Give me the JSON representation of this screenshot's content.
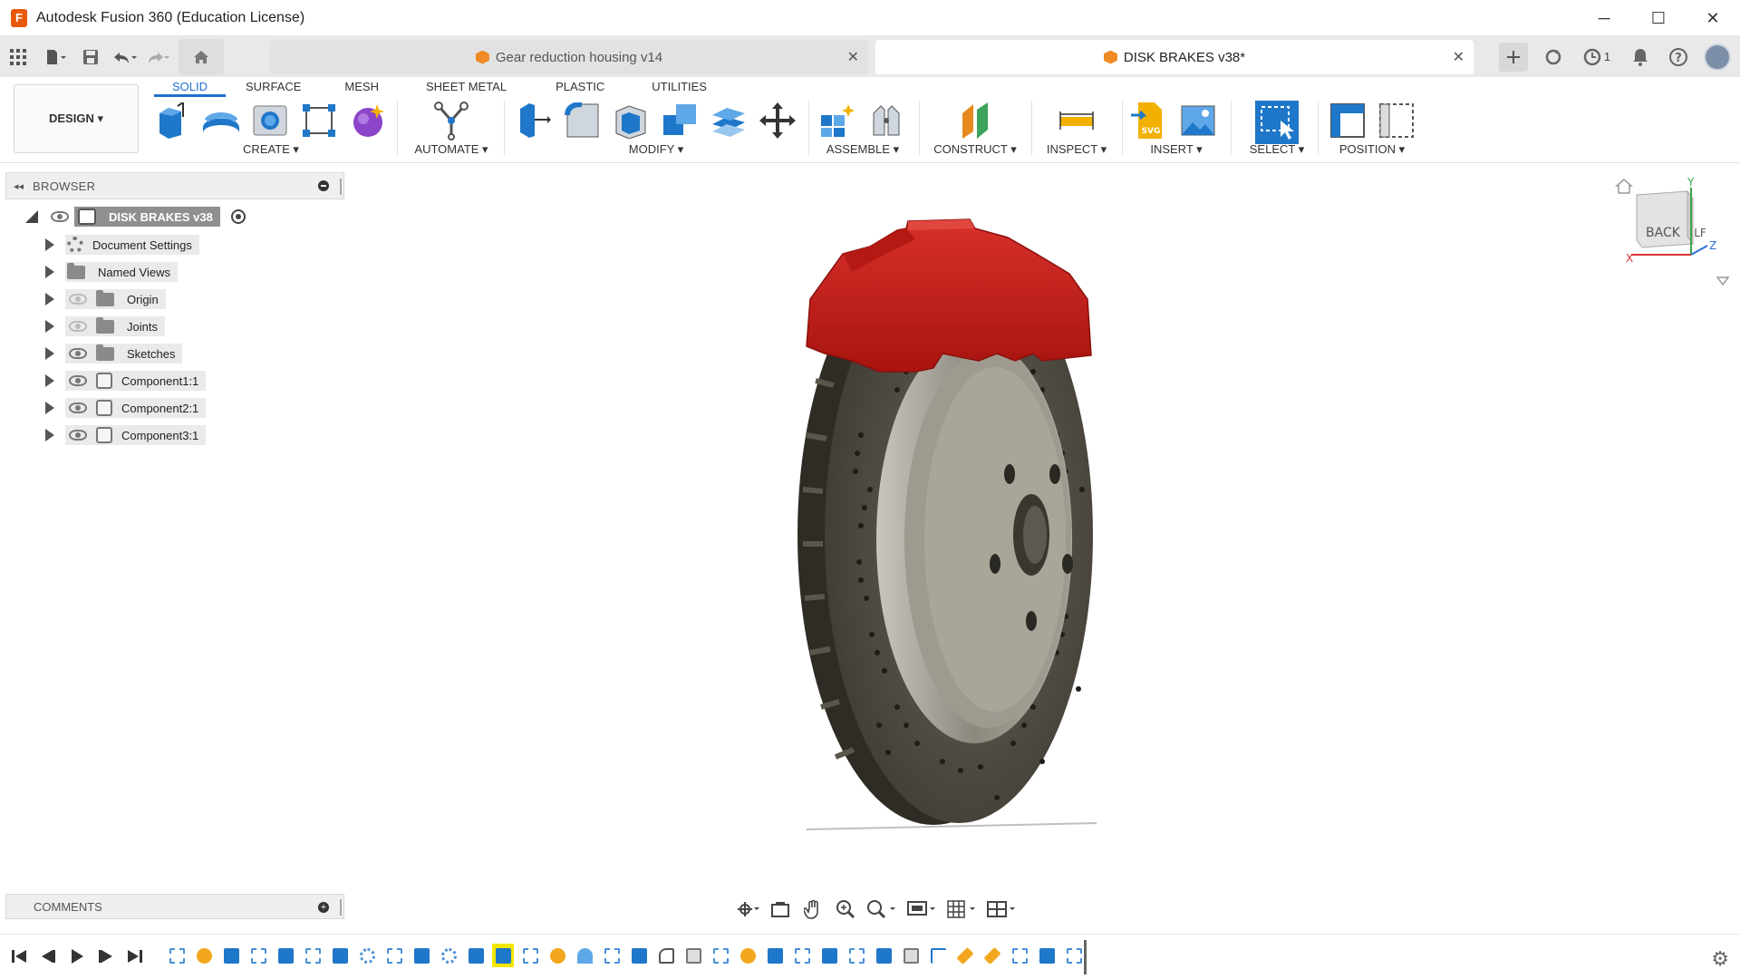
{
  "window": {
    "title": "Autodesk Fusion 360 (Education License)",
    "logo_letter": "F",
    "minimize_icon": "─",
    "maximize_icon": "☐",
    "close_icon": "✕"
  },
  "tabs": [
    {
      "label": "Gear reduction housing v14",
      "active": false
    },
    {
      "label": "DISK BRAKES v38*",
      "active": true
    }
  ],
  "tab_close_icon": "✕",
  "tabbar_right": {
    "notification_count": "1"
  },
  "ribbon": {
    "design_label": "DESIGN ▾",
    "workspace_tabs": [
      "SOLID",
      "SURFACE",
      "MESH",
      "SHEET METAL",
      "PLASTIC",
      "UTILITIES"
    ],
    "groups": {
      "create": "CREATE ▾",
      "automate": "AUTOMATE ▾",
      "modify": "MODIFY ▾",
      "assemble": "ASSEMBLE ▾",
      "construct": "CONSTRUCT ▾",
      "inspect": "INSPECT ▾",
      "insert": "INSERT ▾",
      "select": "SELECT ▾",
      "position": "POSITION ▾"
    }
  },
  "browser": {
    "header": "BROWSER",
    "root": "DISK BRAKES v38",
    "items": [
      {
        "label": "Document Settings",
        "icon": "gear-icon"
      },
      {
        "label": "Named Views",
        "icon": "folder-icon"
      },
      {
        "label": "Origin",
        "icon": "folder-icon",
        "visible": false
      },
      {
        "label": "Joints",
        "icon": "folder-icon",
        "visible": false
      },
      {
        "label": "Sketches",
        "icon": "folder-icon",
        "visible": true
      },
      {
        "label": "Component1:1",
        "icon": "component-icon",
        "visible": true
      },
      {
        "label": "Component2:1",
        "icon": "component-icon",
        "visible": true
      },
      {
        "label": "Component3:1",
        "icon": "component-icon",
        "visible": true
      }
    ]
  },
  "comments": {
    "label": "COMMENTS"
  },
  "viewcube": {
    "face_label": "BACK",
    "side_label": "LF",
    "axis_x": "X",
    "axis_y": "Y",
    "axis_z": "Z"
  },
  "colors": {
    "accent": "#1f6fd1",
    "caliper_red": "#c8201c",
    "disc_dark": "#4e4a40",
    "timeline_selected": "#f3e600"
  }
}
